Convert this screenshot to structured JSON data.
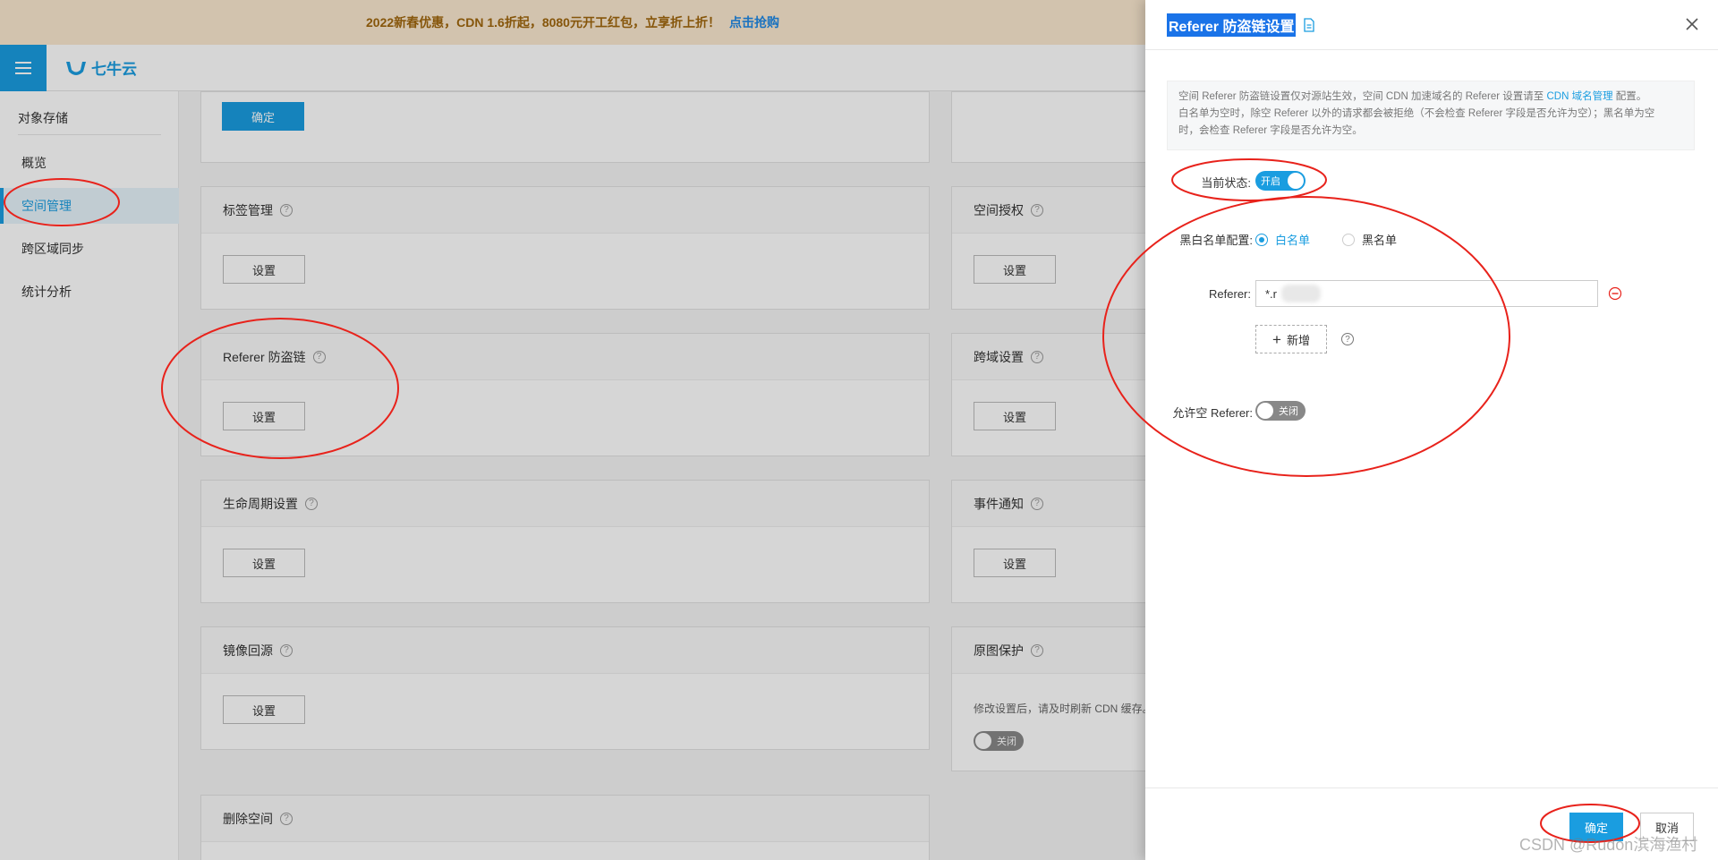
{
  "promo": {
    "text": "2022新春优惠，CDN 1.6折起，8080元开工红包，立享折上折！",
    "link": "点击抢购"
  },
  "header": {
    "logo_text": "七牛云",
    "menu_icon": "hamburger-menu-icon"
  },
  "sidebar": {
    "title": "对象存储",
    "items": [
      {
        "label": "概览",
        "active": false
      },
      {
        "label": "空间管理",
        "active": true
      },
      {
        "label": "跨区域同步",
        "active": false
      },
      {
        "label": "统计分析",
        "active": false
      }
    ]
  },
  "main": {
    "top_confirm": "确定",
    "panels": [
      {
        "title": "标签管理",
        "button": "设置"
      },
      {
        "title": "空间授权",
        "button": "设置"
      },
      {
        "title": "Referer 防盗链",
        "button": "设置"
      },
      {
        "title": "跨域设置",
        "button": "设置"
      },
      {
        "title": "生命周期设置",
        "button": "设置"
      },
      {
        "title": "事件通知",
        "button": "设置"
      },
      {
        "title": "镜像回源",
        "button": "设置"
      },
      {
        "title": "原图保护",
        "note": "修改设置后，请及时刷新 CDN 缓存。",
        "toggle": "关闭"
      },
      {
        "title": "删除空间"
      }
    ]
  },
  "drawer": {
    "title": "Referer 防盗链设置",
    "info": {
      "line1_a": "空间 Referer 防盗链设置仅对源站生效，空间 CDN 加速域名的 Referer 设置请至",
      "line1_link": "CDN 域名管理",
      "line1_b": "配置。",
      "line2": "白名单为空时，除空 Referer 以外的请求都会被拒绝（不会检查 Referer 字段是否允许为空）；黑名单为空",
      "line3": "时，会检查 Referer 字段是否允许为空。"
    },
    "status_label": "当前状态:",
    "status_value": "开启",
    "list_label": "黑白名单配置:",
    "whitelist": "白名单",
    "blacklist": "黑名单",
    "referer_label": "Referer:",
    "referer_value": "*.r        n",
    "add_label": "新增",
    "allow_empty_label": "允许空 Referer:",
    "allow_empty_value": "关闭",
    "ok": "确定",
    "cancel": "取消"
  },
  "watermark": "CSDN @Rudon滨海渔村",
  "colors": {
    "accent": "#1a9de0",
    "annotation": "#e8221b",
    "promo_bg": "#fbe9d0"
  }
}
